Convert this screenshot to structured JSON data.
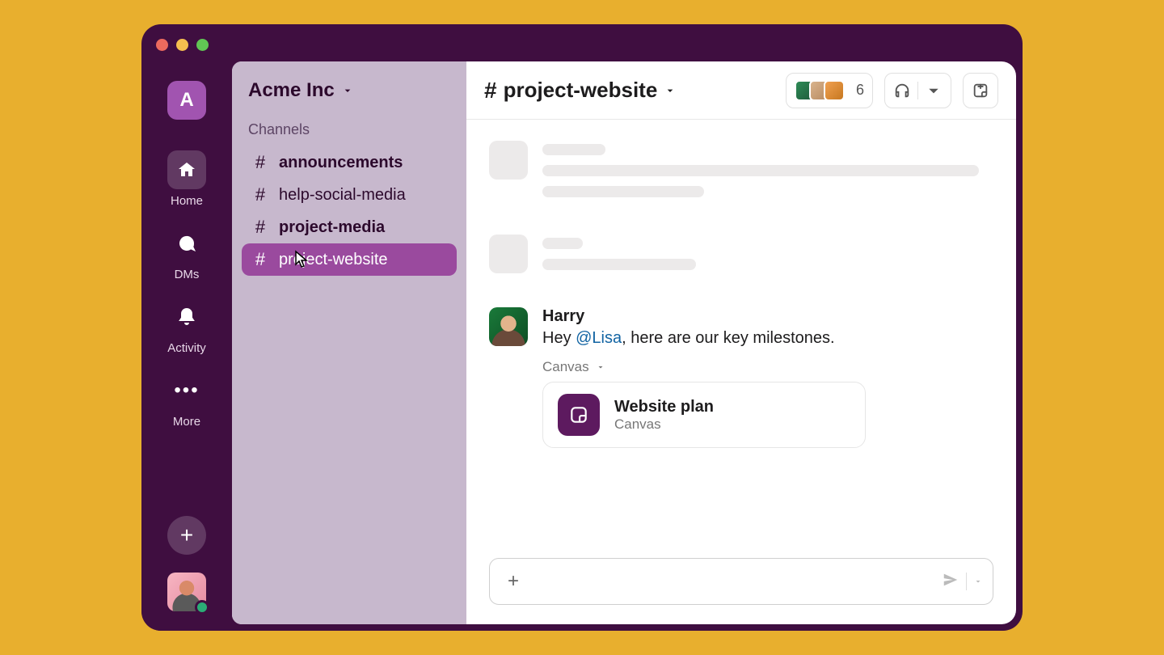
{
  "workspace": {
    "letter": "A",
    "name": "Acme Inc"
  },
  "rail": {
    "home": "Home",
    "dms": "DMs",
    "activity": "Activity",
    "more": "More"
  },
  "sidebar": {
    "section_label": "Channels",
    "channels": [
      {
        "name": "announcements",
        "bold": true,
        "selected": false
      },
      {
        "name": "help-social-media",
        "bold": false,
        "selected": false
      },
      {
        "name": "project-media",
        "bold": true,
        "selected": false
      },
      {
        "name": "project-website",
        "bold": false,
        "selected": true
      }
    ]
  },
  "channel_header": {
    "name": "project-website",
    "member_count": "6"
  },
  "message": {
    "author": "Harry",
    "pre_text": "Hey ",
    "mention": "@Lisa",
    "post_text": ", here are our key milestones."
  },
  "attachment": {
    "label": "Canvas",
    "title": "Website plan",
    "subtitle": "Canvas"
  }
}
